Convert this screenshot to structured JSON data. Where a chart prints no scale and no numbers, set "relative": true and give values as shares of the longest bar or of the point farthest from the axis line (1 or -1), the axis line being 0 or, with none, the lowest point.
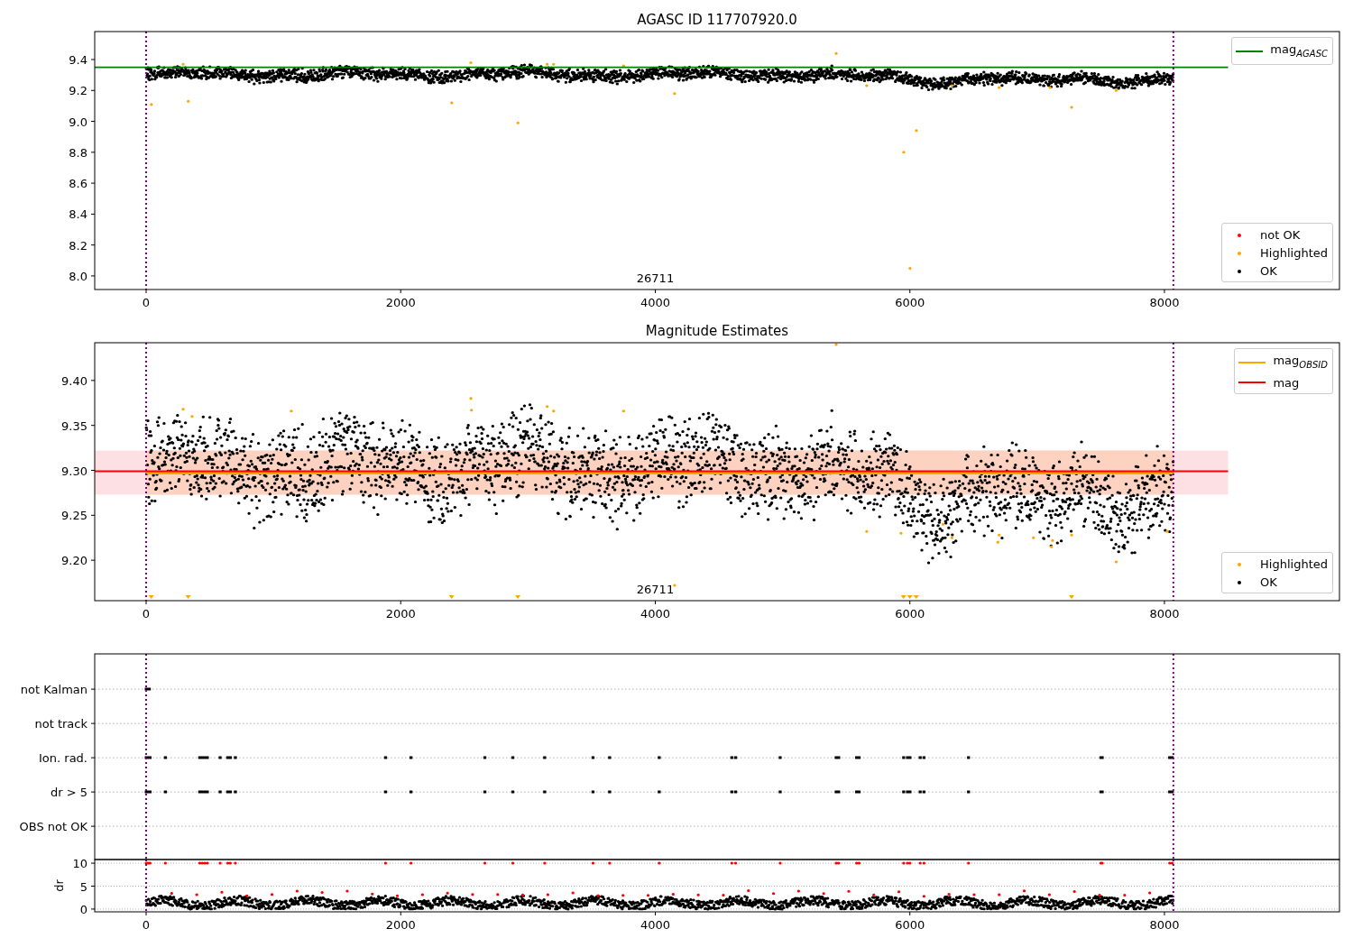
{
  "figure": {
    "panels": [
      {
        "kind": "magnitude",
        "chart_data": {
          "type": "scatter",
          "title": "AGASC ID 117707920.0",
          "xlim": [
            -404,
            9375
          ],
          "ylim": [
            7.912,
            9.581
          ],
          "xticks": [
            0,
            2000,
            4000,
            6000,
            8000
          ],
          "yticks": [
            {
              "value": 8.0,
              "label": "8.0"
            },
            {
              "value": 8.2,
              "label": "8.2"
            },
            {
              "value": 8.4,
              "label": "8.4"
            },
            {
              "value": 8.6,
              "label": "8.6"
            },
            {
              "value": 8.8,
              "label": "8.8"
            },
            {
              "value": 9.0,
              "label": "9.0"
            },
            {
              "value": 9.2,
              "label": "9.2"
            },
            {
              "value": 9.4,
              "label": "9.4"
            }
          ],
          "series": [
            {
              "name": "mag$_{AGASC}$",
              "type": "line",
              "color": "#008000",
              "x": [
                -404,
                8500
              ],
              "values": [
                9.35,
                9.35
              ]
            }
          ],
          "ref_lines": [
            {
              "axis": "x",
              "value": 0,
              "color": "#800080"
            },
            {
              "axis": "x",
              "value": 8070,
              "color": "#800080"
            }
          ],
          "annotations": [
            "26711"
          ]
        },
        "point_legend": [
          {
            "label": "not OK",
            "color": "#ff0000"
          },
          {
            "label": "Highlighted",
            "color": "#ffa500"
          },
          {
            "label": "OK",
            "color": "#000000"
          }
        ]
      },
      {
        "kind": "magnitude",
        "chart_data": {
          "type": "scatter",
          "title": "Magnitude Estimates",
          "xlim": [
            -404,
            9375
          ],
          "ylim": [
            9.155,
            9.442
          ],
          "xticks": [
            0,
            2000,
            4000,
            6000,
            8000
          ],
          "yticks": [
            {
              "value": 9.2,
              "label": "9.20"
            },
            {
              "value": 9.25,
              "label": "9.25"
            },
            {
              "value": 9.3,
              "label": "9.30"
            },
            {
              "value": 9.35,
              "label": "9.35"
            },
            {
              "value": 9.4,
              "label": "9.40"
            }
          ],
          "series": [
            {
              "name": "mag$_{OBSID}$",
              "type": "line",
              "color": "#ffa500",
              "x": [
                0,
                8070
              ],
              "values": [
                9.297,
                9.297
              ]
            },
            {
              "name": "mag",
              "type": "line",
              "color": "#ff0000",
              "x": [
                -404,
                8500
              ],
              "values": [
                9.299,
                9.299
              ]
            }
          ],
          "bands": [
            {
              "axis": "y",
              "from": 9.273,
              "to": 9.322,
              "color": "#fde0e4"
            },
            {
              "axis": "y",
              "from": 9.273,
              "to": 9.322,
              "color": "#fdd2c0"
            }
          ],
          "ref_lines": [
            {
              "axis": "x",
              "value": 0,
              "color": "#800080"
            },
            {
              "axis": "x",
              "value": 8070,
              "color": "#800080"
            }
          ],
          "annotations": [
            "26711"
          ]
        },
        "point_legend": [
          {
            "label": "Highlighted",
            "color": "#ffa500"
          },
          {
            "label": "OK",
            "color": "#000000"
          }
        ]
      },
      {
        "kind": "flags",
        "chart_data": {
          "type": "scatter",
          "orientation": "horizontal",
          "relative": true,
          "grid": true,
          "xlim": [
            -404,
            9375
          ],
          "categories": [
            "not Kalman",
            "not track",
            "Ion. rad.",
            "dr > 5",
            "OBS not OK"
          ],
          "ref_lines": [
            {
              "axis": "x",
              "value": 0,
              "color": "#800080"
            },
            {
              "axis": "x",
              "value": 8070,
              "color": "#800080"
            }
          ]
        }
      },
      {
        "kind": "dr",
        "chart_data": {
          "type": "scatter",
          "ylabel": "dr",
          "grid": true,
          "xlim": [
            -404,
            9375
          ],
          "ylim": [
            -0.6,
            10.8
          ],
          "xticks": [
            0,
            2000,
            4000,
            6000,
            8000
          ],
          "yticks": [
            {
              "value": 0,
              "label": "0"
            },
            {
              "value": 5,
              "label": "5"
            },
            {
              "value": 10,
              "label": "10"
            }
          ],
          "ref_lines": [
            {
              "axis": "x",
              "value": 0,
              "color": "#800080"
            },
            {
              "axis": "x",
              "value": 8070,
              "color": "#800080"
            }
          ]
        }
      }
    ]
  }
}
